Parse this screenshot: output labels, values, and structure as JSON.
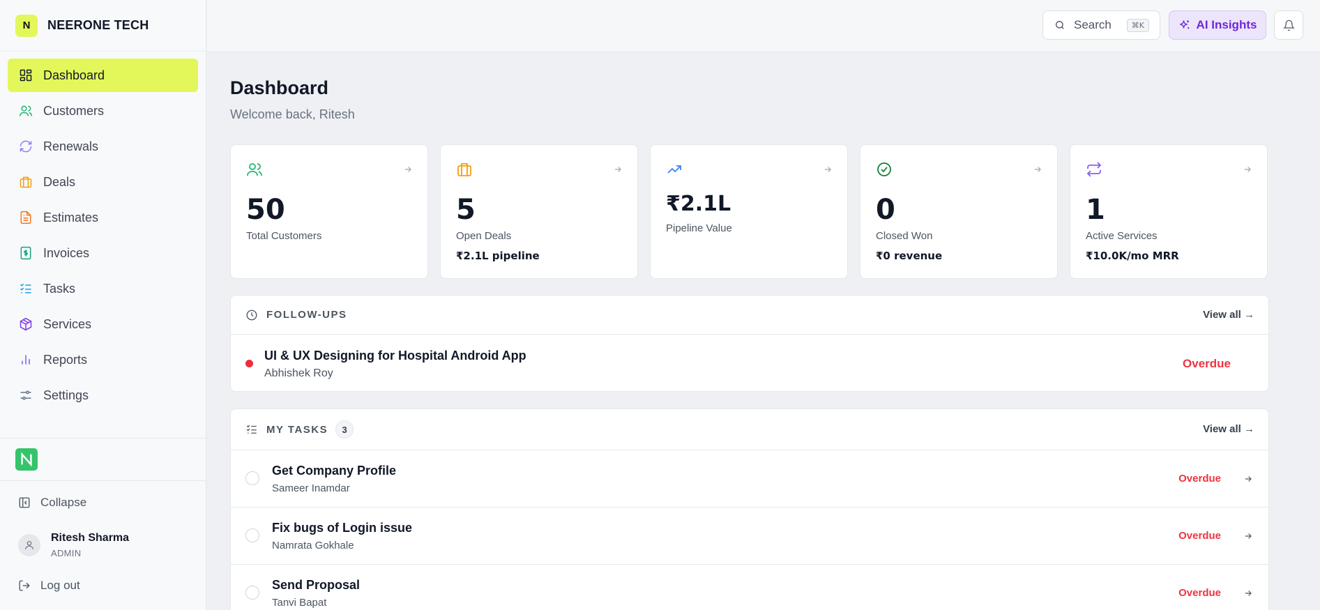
{
  "brand": {
    "initial": "N",
    "name": "NEERONE TECH"
  },
  "sidebar": {
    "items": [
      {
        "label": "Dashboard",
        "icon": "layout-grid-icon",
        "active": true
      },
      {
        "label": "Customers",
        "icon": "users-icon"
      },
      {
        "label": "Renewals",
        "icon": "refresh-icon"
      },
      {
        "label": "Deals",
        "icon": "briefcase-icon"
      },
      {
        "label": "Estimates",
        "icon": "file-text-icon"
      },
      {
        "label": "Invoices",
        "icon": "receipt-icon"
      },
      {
        "label": "Tasks",
        "icon": "list-checks-icon"
      },
      {
        "label": "Services",
        "icon": "package-icon"
      },
      {
        "label": "Reports",
        "icon": "bar-chart-icon"
      },
      {
        "label": "Settings",
        "icon": "sliders-icon"
      }
    ],
    "collapse_label": "Collapse",
    "user": {
      "name": "Ritesh Sharma",
      "role": "ADMIN"
    },
    "logout_label": "Log out"
  },
  "topbar": {
    "search_label": "Search",
    "search_shortcut": "⌘K",
    "ai_label": "AI Insights"
  },
  "page": {
    "title": "Dashboard",
    "subtitle": "Welcome back, Ritesh"
  },
  "stats": [
    {
      "value": "50",
      "label": "Total Customers",
      "sub": "",
      "icon": "users-icon",
      "color": "#22b573"
    },
    {
      "value": "5",
      "label": "Open Deals",
      "sub": "₹2.1L pipeline",
      "icon": "briefcase-icon",
      "color": "#f59e0b"
    },
    {
      "value": "₹2.1L",
      "label": "Pipeline Value",
      "sub": "",
      "icon": "trending-up-icon",
      "color": "#3b82f6"
    },
    {
      "value": "0",
      "label": "Closed Won",
      "sub": "₹0 revenue",
      "icon": "check-circle-icon",
      "color": "#15803d"
    },
    {
      "value": "1",
      "label": "Active Services",
      "sub": "₹10.0K/mo MRR",
      "icon": "repeat-icon",
      "color": "#8b5cf6"
    }
  ],
  "followups": {
    "heading": "FOLLOW-UPS",
    "view_all": "View all →",
    "items": [
      {
        "title": "UI & UX Designing for Hospital Android App",
        "person": "Abhishek Roy",
        "status": "Overdue"
      }
    ]
  },
  "tasks": {
    "heading": "MY TASKS",
    "count": "3",
    "view_all": "View all →",
    "items": [
      {
        "title": "Get Company Profile",
        "person": "Sameer Inamdar",
        "status": "Overdue"
      },
      {
        "title": "Fix bugs of Login issue",
        "person": "Namrata Gokhale",
        "status": "Overdue"
      },
      {
        "title": "Send Proposal",
        "person": "Tanvi Bapat",
        "status": "Overdue"
      }
    ]
  },
  "colors": {
    "accent": "#e3f75a",
    "overdue": "#ef3340",
    "ai": "#6d28d9"
  }
}
